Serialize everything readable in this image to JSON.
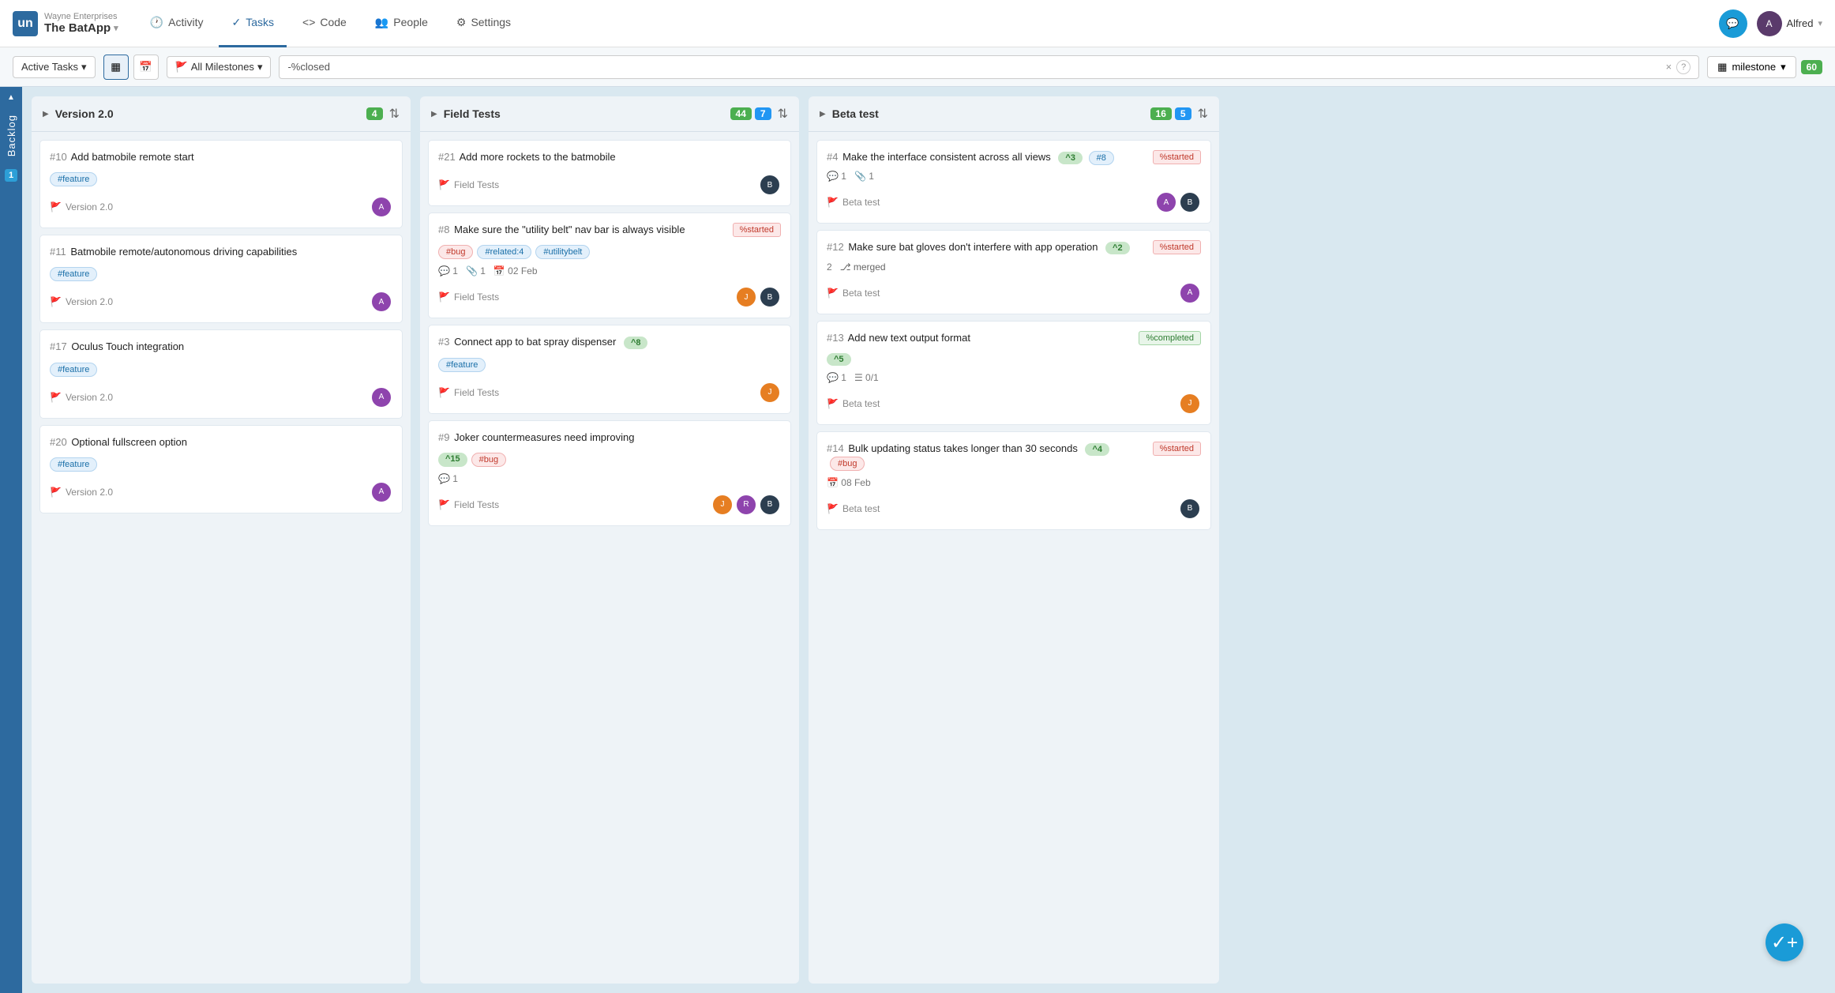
{
  "app": {
    "company": "Wayne Enterprises",
    "name": "The BatApp",
    "chevron": "▾"
  },
  "nav": {
    "items": [
      {
        "id": "activity",
        "label": "Activity",
        "icon": "🕐",
        "active": false
      },
      {
        "id": "tasks",
        "label": "Tasks",
        "icon": "✓",
        "active": true
      },
      {
        "id": "code",
        "label": "Code",
        "icon": "<>",
        "active": false
      },
      {
        "id": "people",
        "label": "People",
        "icon": "👥",
        "active": false
      },
      {
        "id": "settings",
        "label": "Settings",
        "icon": "⚙",
        "active": false
      }
    ],
    "user": "Alfred",
    "chevron": "▾"
  },
  "toolbar": {
    "active_tasks": "Active Tasks",
    "all_milestones": "All Milestones",
    "search_value": "-%closed",
    "milestone_label": "milestone",
    "count": "60",
    "clear_icon": "×",
    "help_icon": "?"
  },
  "backlog": {
    "label": "Backlog",
    "number": "1"
  },
  "columns": [
    {
      "id": "version2",
      "title": "Version 2.0",
      "badge_count": "4",
      "tasks": [
        {
          "id": 10,
          "title": "Add batmobile remote start",
          "tags": [
            {
              "label": "#feature",
              "type": "feature"
            }
          ],
          "milestone": "Version 2.0",
          "avatars": [
            "purple"
          ],
          "status": null,
          "meta": []
        },
        {
          "id": 11,
          "title": "Batmobile remote/autonomous driving capabilities",
          "tags": [
            {
              "label": "#feature",
              "type": "feature"
            }
          ],
          "milestone": "Version 2.0",
          "avatars": [
            "purple"
          ],
          "status": null,
          "meta": []
        },
        {
          "id": 17,
          "title": "Oculus Touch integration",
          "tags": [
            {
              "label": "#feature",
              "type": "feature"
            }
          ],
          "milestone": "Version 2.0",
          "avatars": [
            "purple"
          ],
          "status": null,
          "meta": []
        },
        {
          "id": 20,
          "title": "Optional fullscreen option",
          "tags": [
            {
              "label": "#feature",
              "type": "feature"
            }
          ],
          "milestone": "Version 2.0",
          "avatars": [
            "purple"
          ],
          "status": null,
          "meta": []
        }
      ]
    },
    {
      "id": "field-tests",
      "title": "Field Tests",
      "badge_count": "44",
      "badge_count2": "7",
      "tasks": [
        {
          "id": 21,
          "title": "Add more rockets to the batmobile",
          "tags": [],
          "milestone": "Field Tests",
          "avatars": [
            "purple2"
          ],
          "status": null,
          "meta": []
        },
        {
          "id": 8,
          "title": "Make sure the \"utility belt\" nav bar is always visible",
          "tags": [
            {
              "label": "#bug",
              "type": "bug"
            },
            {
              "label": "#related:4",
              "type": "related"
            },
            {
              "label": "#utilitybelt",
              "type": "utilitybelt"
            }
          ],
          "milestone": "Field Tests",
          "avatars": [
            "orange",
            "purple2"
          ],
          "status": "started",
          "meta": [
            "1",
            "1",
            "02 Feb"
          ]
        },
        {
          "id": 3,
          "title": "Connect app to bat spray dispenser",
          "tags": [
            {
              "label": "#feature",
              "type": "feature"
            }
          ],
          "priority": "^8",
          "milestone": "Field Tests",
          "avatars": [
            "orange2"
          ],
          "status": null,
          "meta": []
        },
        {
          "id": 9,
          "title": "Joker countermeasures need improving",
          "tags": [
            {
              "label": "#bug",
              "type": "bug"
            }
          ],
          "priority": "^15",
          "milestone": "Field Tests",
          "avatars": [
            "orange3",
            "purple3",
            "dark"
          ],
          "status": null,
          "meta": [
            "1"
          ]
        }
      ]
    },
    {
      "id": "beta-test",
      "title": "Beta test",
      "badge_count": "16",
      "badge_count2": "5",
      "tasks": [
        {
          "id": 4,
          "title": "Make the interface consistent across all views",
          "tags": [],
          "priority": "^3",
          "linked": "#8",
          "milestone": "Beta test",
          "avatars": [
            "purple4",
            "dark2"
          ],
          "status": "started",
          "meta": [
            "1",
            "1"
          ]
        },
        {
          "id": 12,
          "title": "Make sure bat gloves don't interfere with app operation",
          "tags": [],
          "priority": "^2",
          "milestone": "Beta test",
          "avatars": [
            "purple5"
          ],
          "status": "started",
          "merged": true,
          "meta": [
            "2"
          ]
        },
        {
          "id": 13,
          "title": "Add new text output format",
          "tags": [],
          "priority": "^5",
          "milestone": "Beta test",
          "avatars": [
            "orange4"
          ],
          "status": "completed",
          "meta": [
            "1",
            "0/1"
          ]
        },
        {
          "id": 14,
          "title": "Bulk updating status takes longer than 30 seconds",
          "tags": [
            {
              "label": "#bug",
              "type": "bug"
            }
          ],
          "priority": "^4",
          "milestone": "Beta test",
          "avatars": [
            "purple6"
          ],
          "status": "started",
          "date": "08 Feb",
          "meta": []
        }
      ]
    }
  ]
}
